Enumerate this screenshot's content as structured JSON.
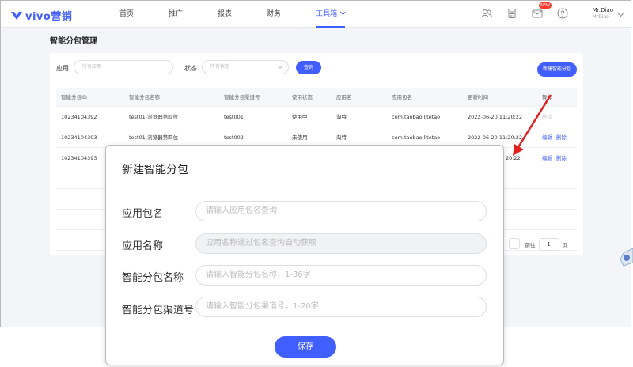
{
  "brand": {
    "name": "vivo营销",
    "color": "#415fff"
  },
  "nav": {
    "items": [
      "首页",
      "推广",
      "报表",
      "财务",
      "工具箱"
    ],
    "active_index": 4
  },
  "header": {
    "new_badge": "NEW",
    "user_name": "Mr.Diao",
    "user_sub": "MrDiao",
    "icons": [
      "users-icon",
      "clipboard-icon",
      "mail-icon",
      "help-icon"
    ]
  },
  "page": {
    "title": "智能分包管理"
  },
  "filters": {
    "app_label": "应用",
    "app_placeholder": "所有应用",
    "status_label": "状态",
    "status_placeholder": "所有状态",
    "query_label": "查询",
    "new_label": "新建智能分包"
  },
  "table": {
    "columns": [
      "智能分包ID",
      "智能分包名称",
      "智能分包渠道号",
      "使用状态",
      "应用名",
      "应用包名",
      "更新时间",
      "操作"
    ],
    "rows": [
      {
        "id": "10234104392",
        "name": "test01-浏览器第四位",
        "channel": "test001",
        "status": "使用中",
        "app": "淘特",
        "pkg": "com.taobao.litetao",
        "time": "2022-06-20 11:20:22",
        "ops": [
          "删除"
        ],
        "ops_disabled": true
      },
      {
        "id": "10234104393",
        "name": "test01-浏览器第四位",
        "channel": "test002",
        "status": "未使用",
        "app": "淘特",
        "pkg": "com.taobao.litetao",
        "time": "2022-06-20 11:20:22",
        "ops": [
          "编辑",
          "删除"
        ],
        "ops_disabled": false
      },
      {
        "id": "10234104393",
        "time_tail": "20:22",
        "ops": [
          "编辑",
          "删除"
        ]
      }
    ]
  },
  "pager": {
    "goto_label": "前往",
    "page_value": "1",
    "page_unit": "页"
  },
  "modal": {
    "title": "新建智能分包",
    "fields": [
      {
        "label": "应用包名",
        "placeholder": "请输入应用包名查询"
      },
      {
        "label": "应用名称",
        "placeholder": "应用名称通过包名查询自动获取"
      },
      {
        "label": "智能分包名称",
        "placeholder": "请输入智能分包名称，1-36字"
      },
      {
        "label": "智能分包渠道号",
        "placeholder": "请输入智能分包渠道号，1-20字"
      }
    ],
    "save_label": "保存"
  },
  "colors": {
    "arrow": "#e02020",
    "link": "#415fff"
  }
}
